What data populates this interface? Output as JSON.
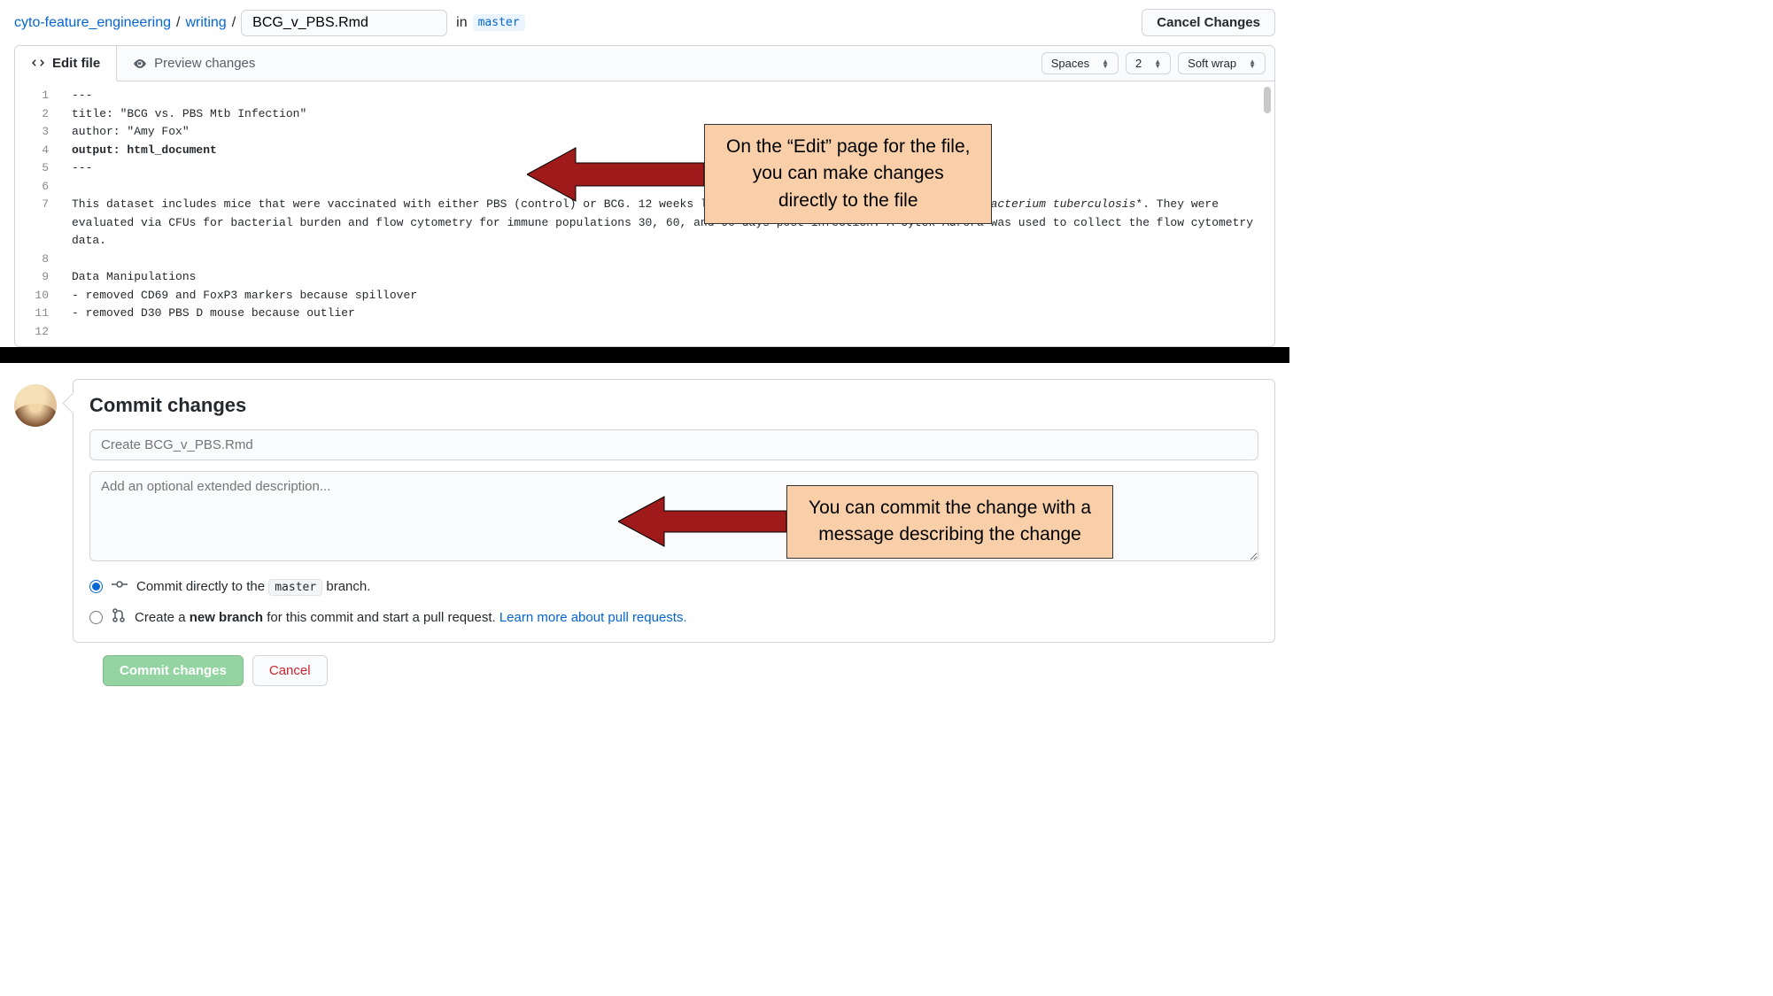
{
  "breadcrumb": {
    "repo": "cyto-feature_engineering",
    "folder": "writing",
    "filename": "BCG_v_PBS.Rmd",
    "in_label": "in",
    "branch": "master"
  },
  "cancel_changes_label": "Cancel Changes",
  "tabs": {
    "edit": "Edit file",
    "preview": "Preview changes"
  },
  "editor_options": {
    "indent_mode": "Spaces",
    "indent_size": "2",
    "wrap_mode": "Soft wrap"
  },
  "code_lines": [
    {
      "n": 1,
      "text": "---"
    },
    {
      "n": 2,
      "text": "title: \"BCG vs. PBS Mtb Infection\""
    },
    {
      "n": 3,
      "text": "author: \"Amy Fox\""
    },
    {
      "n": 4,
      "text": "output:",
      "bold_after": "html_document"
    },
    {
      "n": 5,
      "text": "---"
    },
    {
      "n": 6,
      "text": ""
    },
    {
      "n": 7,
      "text": "This dataset includes mice that were vaccinated with either PBS (control) or BCG. 12 weeks later these mice were infected with *",
      "italic": "Mycobacterium tuberculosis",
      "after": "*. They were evaluated via CFUs for bacterial burden and flow cytometry for immune populations 30, 60, and 90 days post-infection. A Cytek Aurora was used to collect the flow cytometry data."
    },
    {
      "n": 8,
      "text": ""
    },
    {
      "n": 9,
      "text": "Data Manipulations"
    },
    {
      "n": 10,
      "text": "- removed CD69 and FoxP3 markers because spillover"
    },
    {
      "n": 11,
      "text": "- removed D30 PBS D mouse because outlier"
    },
    {
      "n": 12,
      "text": ""
    }
  ],
  "callout1": {
    "line1": "On the “Edit” page for the file,",
    "line2": "you can make changes",
    "line3": "directly to the file"
  },
  "commit": {
    "heading": "Commit changes",
    "summary_placeholder": "Create BCG_v_PBS.Rmd",
    "description_placeholder": "Add an optional extended description...",
    "radio_direct_pre": "Commit directly to the ",
    "radio_direct_branch": "master",
    "radio_direct_post": " branch.",
    "radio_newbranch_pre": "Create a ",
    "radio_newbranch_bold": "new branch",
    "radio_newbranch_mid": " for this commit and start a pull request. ",
    "radio_newbranch_link": "Learn more about pull requests.",
    "commit_button": "Commit changes",
    "cancel_button": "Cancel"
  },
  "callout2": {
    "line1": "You can commit the change with a",
    "line2": "message describing the change"
  }
}
